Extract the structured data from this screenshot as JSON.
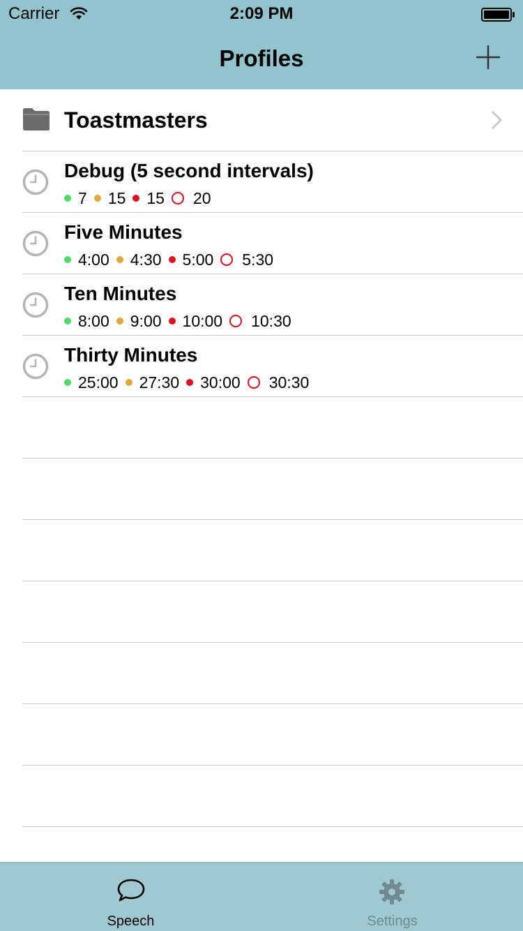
{
  "status_bar": {
    "carrier": "Carrier",
    "time": "2:09 PM"
  },
  "nav": {
    "title": "Profiles",
    "add_icon": "plus-icon"
  },
  "folder": {
    "label": "Toastmasters",
    "icon": "folder-icon"
  },
  "profiles": [
    {
      "title": "Debug (5 second intervals)",
      "green": "7",
      "yellow": "15",
      "red": "15",
      "over": "20"
    },
    {
      "title": "Five Minutes",
      "green": "4:00",
      "yellow": "4:30",
      "red": "5:00",
      "over": "5:30"
    },
    {
      "title": "Ten Minutes",
      "green": "8:00",
      "yellow": "9:00",
      "red": "10:00",
      "over": "10:30"
    },
    {
      "title": "Thirty Minutes",
      "green": "25:00",
      "yellow": "27:30",
      "red": "30:00",
      "over": "30:30"
    }
  ],
  "colors": {
    "green": "#4cd964",
    "yellow": "#e0a83a",
    "red": "#e01020",
    "nav_bg": "#93c4ce",
    "tab_bg": "#a0c8d0"
  },
  "tabbar": {
    "speech": {
      "label": "Speech",
      "icon": "speech-bubble-icon"
    },
    "settings": {
      "label": "Settings",
      "icon": "gear-icon"
    }
  }
}
